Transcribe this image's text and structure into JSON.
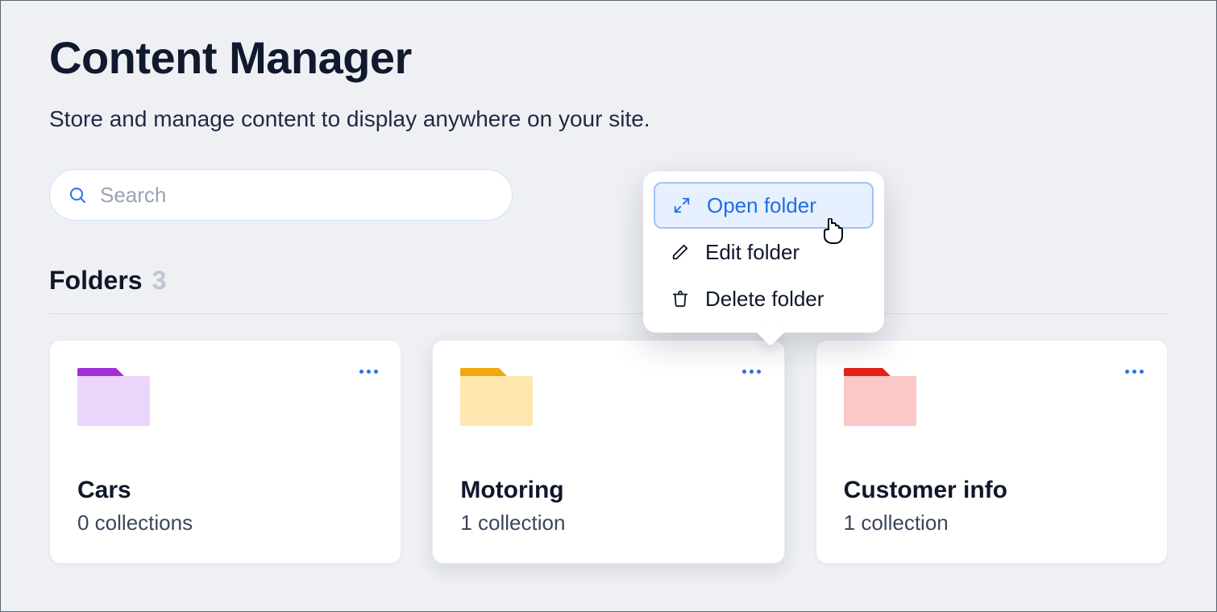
{
  "header": {
    "title": "Content Manager",
    "subtitle": "Store and manage content to display anywhere on your site."
  },
  "search": {
    "placeholder": "Search"
  },
  "folders_section": {
    "label": "Folders",
    "count": "3"
  },
  "folders": [
    {
      "name": "Cars",
      "meta": "0 collections",
      "color": "purple"
    },
    {
      "name": "Motoring",
      "meta": "1 collection",
      "color": "yellow"
    },
    {
      "name": "Customer info",
      "meta": "1 collection",
      "color": "red"
    }
  ],
  "context_menu": {
    "open": "Open folder",
    "edit": "Edit folder",
    "delete": "Delete folder"
  }
}
